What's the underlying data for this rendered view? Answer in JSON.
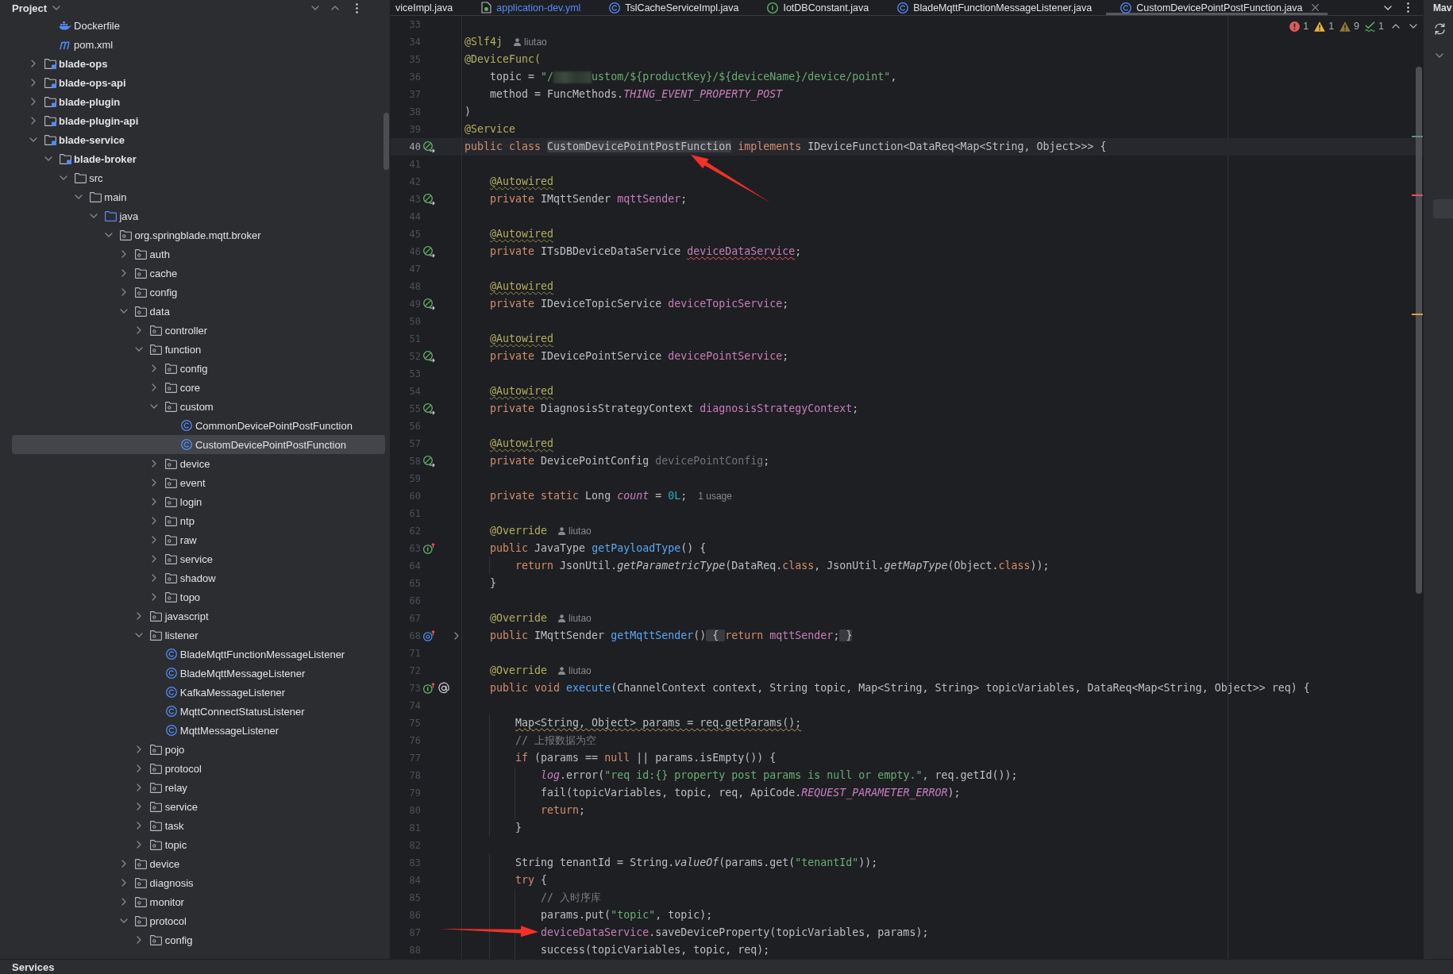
{
  "project": {
    "title": "Project",
    "tree": [
      {
        "children": [
          {
            "label": "Dockerfile",
            "kind": "docker",
            "selected": false
          },
          {
            "label": "pom.xml",
            "kind": "maven",
            "selected": false
          }
        ]
      },
      {
        "label": "blade-ops",
        "kind": "module",
        "expanded": false,
        "selected": false
      },
      {
        "label": "blade-ops-api",
        "kind": "module",
        "expanded": false,
        "selected": false
      },
      {
        "label": "blade-plugin",
        "kind": "module",
        "expanded": false,
        "selected": false
      },
      {
        "label": "blade-plugin-api",
        "kind": "module",
        "expanded": false,
        "selected": false
      },
      {
        "label": "blade-service",
        "kind": "module",
        "expanded": true,
        "selected": false,
        "children": [
          {
            "label": "blade-broker",
            "kind": "module",
            "expanded": true,
            "selected": false,
            "children": [
              {
                "label": "src",
                "kind": "folder",
                "expanded": true,
                "selected": false,
                "children": [
                  {
                    "label": "main",
                    "kind": "folder",
                    "expanded": true,
                    "selected": false,
                    "children": [
                      {
                        "label": "java",
                        "kind": "source-folder",
                        "expanded": true,
                        "selected": false,
                        "children": [
                          {
                            "label": "org.springblade.mqtt.broker",
                            "kind": "package",
                            "expanded": true,
                            "selected": false,
                            "children": [
                              {
                                "label": "auth",
                                "kind": "package",
                                "expanded": false,
                                "selected": false
                              },
                              {
                                "label": "cache",
                                "kind": "package",
                                "expanded": false,
                                "selected": false
                              },
                              {
                                "label": "config",
                                "kind": "package",
                                "expanded": false,
                                "selected": false
                              },
                              {
                                "label": "data",
                                "kind": "package",
                                "expanded": true,
                                "selected": false,
                                "children": [
                                  {
                                    "label": "controller",
                                    "kind": "package",
                                    "expanded": false,
                                    "selected": false
                                  },
                                  {
                                    "label": "function",
                                    "kind": "package",
                                    "expanded": true,
                                    "selected": false,
                                    "children": [
                                      {
                                        "label": "config",
                                        "kind": "package",
                                        "expanded": false,
                                        "selected": false
                                      },
                                      {
                                        "label": "core",
                                        "kind": "package",
                                        "expanded": false,
                                        "selected": false
                                      },
                                      {
                                        "label": "custom",
                                        "kind": "package",
                                        "expanded": true,
                                        "selected": false,
                                        "children": [
                                          {
                                            "label": "CommonDevicePointPostFunction",
                                            "kind": "class",
                                            "selected": false
                                          },
                                          {
                                            "label": "CustomDevicePointPostFunction",
                                            "kind": "class",
                                            "selected": true
                                          }
                                        ]
                                      },
                                      {
                                        "label": "device",
                                        "kind": "package",
                                        "expanded": false,
                                        "selected": false
                                      },
                                      {
                                        "label": "event",
                                        "kind": "package",
                                        "expanded": false,
                                        "selected": false
                                      },
                                      {
                                        "label": "login",
                                        "kind": "package",
                                        "expanded": false,
                                        "selected": false
                                      },
                                      {
                                        "label": "ntp",
                                        "kind": "package",
                                        "expanded": false,
                                        "selected": false
                                      },
                                      {
                                        "label": "raw",
                                        "kind": "package",
                                        "expanded": false,
                                        "selected": false
                                      },
                                      {
                                        "label": "service",
                                        "kind": "package",
                                        "expanded": false,
                                        "selected": false
                                      },
                                      {
                                        "label": "shadow",
                                        "kind": "package",
                                        "expanded": false,
                                        "selected": false
                                      },
                                      {
                                        "label": "topo",
                                        "kind": "package",
                                        "expanded": false,
                                        "selected": false
                                      }
                                    ]
                                  },
                                  {
                                    "label": "javascript",
                                    "kind": "package",
                                    "expanded": false,
                                    "selected": false
                                  },
                                  {
                                    "label": "listener",
                                    "kind": "package",
                                    "expanded": true,
                                    "selected": false,
                                    "children": [
                                      {
                                        "label": "BladeMqttFunctionMessageListener",
                                        "kind": "class",
                                        "selected": false
                                      },
                                      {
                                        "label": "BladeMqttMessageListener",
                                        "kind": "class",
                                        "selected": false
                                      },
                                      {
                                        "label": "KafkaMessageListener",
                                        "kind": "class",
                                        "selected": false
                                      },
                                      {
                                        "label": "MqttConnectStatusListener",
                                        "kind": "class",
                                        "selected": false
                                      },
                                      {
                                        "label": "MqttMessageListener",
                                        "kind": "class",
                                        "selected": false
                                      }
                                    ]
                                  },
                                  {
                                    "label": "pojo",
                                    "kind": "package",
                                    "expanded": false,
                                    "selected": false
                                  },
                                  {
                                    "label": "protocol",
                                    "kind": "package",
                                    "expanded": false,
                                    "selected": false
                                  },
                                  {
                                    "label": "relay",
                                    "kind": "package",
                                    "expanded": false,
                                    "selected": false
                                  },
                                  {
                                    "label": "service",
                                    "kind": "package",
                                    "expanded": false,
                                    "selected": false
                                  },
                                  {
                                    "label": "task",
                                    "kind": "package",
                                    "expanded": false,
                                    "selected": false
                                  },
                                  {
                                    "label": "topic",
                                    "kind": "package",
                                    "expanded": false,
                                    "selected": false
                                  }
                                ]
                              },
                              {
                                "label": "device",
                                "kind": "package",
                                "expanded": false,
                                "selected": false
                              },
                              {
                                "label": "diagnosis",
                                "kind": "package",
                                "expanded": false,
                                "selected": false
                              },
                              {
                                "label": "monitor",
                                "kind": "package",
                                "expanded": false,
                                "selected": false
                              },
                              {
                                "label": "protocol",
                                "kind": "package",
                                "expanded": true,
                                "selected": false,
                                "children": [
                                  {
                                    "label": "config",
                                    "kind": "package",
                                    "expanded": false,
                                    "selected": false
                                  }
                                ]
                              }
                            ]
                          }
                        ]
                      }
                    ]
                  }
                ]
              }
            ]
          }
        ]
      }
    ]
  },
  "editor": {
    "tabs": [
      {
        "label": "viceImpl.java",
        "selected": false,
        "modified": false
      },
      {
        "label": "application-dev.yml",
        "kind": "yaml",
        "selected": false,
        "modified": true
      },
      {
        "label": "TslCacheServiceImpl.java",
        "kind": "class",
        "selected": false,
        "modified": false
      },
      {
        "label": "IotDBConstant.java",
        "kind": "interface",
        "selected": false,
        "modified": false
      },
      {
        "label": "BladeMqttFunctionMessageListener.java",
        "kind": "class",
        "selected": false,
        "modified": false
      },
      {
        "label": "CustomDevicePointPostFunction.java",
        "kind": "class",
        "selected": true,
        "modified": false
      }
    ],
    "inspections": [
      {
        "kind": "error",
        "count": "1"
      },
      {
        "kind": "warning",
        "count": "1"
      },
      {
        "kind": "weak-warning",
        "count": "9"
      },
      {
        "kind": "typo",
        "count": "1"
      }
    ],
    "lines": [
      {
        "number": "33",
        "current": false
      },
      {
        "number": "34",
        "current": false,
        "tokens": [
          {
            "text": "@Slf4j",
            "kind": "annotation"
          }
        ],
        "hint": {
          "kind": "author",
          "text": "liutao"
        }
      },
      {
        "number": "35",
        "current": false,
        "tokens": [
          {
            "text": "@DeviceFunc(",
            "kind": "annotation"
          }
        ]
      },
      {
        "number": "36",
        "current": false,
        "tokens": [
          {
            "text": "    topic = ",
            "kind": "plain"
          },
          {
            "text": "\"/",
            "kind": "string"
          },
          {
            "kind": "redacted"
          },
          {
            "text": "ustom/${productKey}/${deviceName}/device/point\"",
            "kind": "string"
          },
          {
            "text": ",",
            "kind": "plain"
          }
        ]
      },
      {
        "number": "37",
        "current": false,
        "tokens": [
          {
            "text": "    method = FuncMethods.",
            "kind": "plain"
          },
          {
            "text": "THING_EVENT_PROPERTY_POST",
            "kind": "static-field"
          }
        ]
      },
      {
        "number": "38",
        "current": false,
        "tokens": [
          {
            "text": ")",
            "kind": "plain"
          }
        ]
      },
      {
        "number": "39",
        "current": false,
        "tokens": [
          {
            "text": "@Service",
            "kind": "annotation"
          }
        ]
      },
      {
        "number": "40",
        "current": true,
        "gutter": [
          {
            "kind": "bean"
          }
        ],
        "tokens": [
          {
            "text": "public class ",
            "kind": "keyword"
          },
          {
            "text": "CustomDevicePointPostFunction",
            "kind": "plain",
            "highlight": true,
            "pointer": {
              "kind": "from-below-right"
            }
          },
          {
            "text": " implements ",
            "kind": "keyword"
          },
          {
            "text": "IDeviceFunction<DataReq<Map<String, Object>>> {",
            "kind": "plain"
          }
        ]
      },
      {
        "number": "41",
        "current": false
      },
      {
        "number": "42",
        "current": false,
        "tokens": [
          {
            "text": "    @Autowired",
            "kind": "annotation",
            "squiggle": {
              "kind": "weak"
            }
          }
        ]
      },
      {
        "number": "43",
        "current": false,
        "gutter": [
          {
            "kind": "bean"
          }
        ],
        "tokens": [
          {
            "text": "    private ",
            "kind": "keyword"
          },
          {
            "text": "IMqttSender ",
            "kind": "plain"
          },
          {
            "text": "mqttSender",
            "kind": "field"
          },
          {
            "text": ";",
            "kind": "plain"
          }
        ]
      },
      {
        "number": "44",
        "current": false
      },
      {
        "number": "45",
        "current": false,
        "tokens": [
          {
            "text": "    @Autowired",
            "kind": "annotation",
            "squiggle": {
              "kind": "weak"
            }
          }
        ]
      },
      {
        "number": "46",
        "current": false,
        "gutter": [
          {
            "kind": "bean"
          }
        ],
        "tokens": [
          {
            "text": "    private ",
            "kind": "keyword"
          },
          {
            "text": "ITsDBDeviceDataService ",
            "kind": "plain"
          },
          {
            "text": "deviceDataService",
            "kind": "field",
            "squiggle": {
              "kind": "error"
            }
          },
          {
            "text": ";",
            "kind": "plain"
          }
        ]
      },
      {
        "number": "47",
        "current": false
      },
      {
        "number": "48",
        "current": false,
        "tokens": [
          {
            "text": "    @Autowired",
            "kind": "annotation",
            "squiggle": {
              "kind": "weak"
            }
          }
        ]
      },
      {
        "number": "49",
        "current": false,
        "gutter": [
          {
            "kind": "bean"
          }
        ],
        "tokens": [
          {
            "text": "    private ",
            "kind": "keyword"
          },
          {
            "text": "IDeviceTopicService ",
            "kind": "plain"
          },
          {
            "text": "deviceTopicService",
            "kind": "field"
          },
          {
            "text": ";",
            "kind": "plain"
          }
        ]
      },
      {
        "number": "50",
        "current": false
      },
      {
        "number": "51",
        "current": false,
        "tokens": [
          {
            "text": "    @Autowired",
            "kind": "annotation",
            "squiggle": {
              "kind": "weak"
            }
          }
        ]
      },
      {
        "number": "52",
        "current": false,
        "gutter": [
          {
            "kind": "bean"
          }
        ],
        "tokens": [
          {
            "text": "    private ",
            "kind": "keyword"
          },
          {
            "text": "IDevicePointService ",
            "kind": "plain"
          },
          {
            "text": "devicePointService",
            "kind": "field"
          },
          {
            "text": ";",
            "kind": "plain"
          }
        ]
      },
      {
        "number": "53",
        "current": false
      },
      {
        "number": "54",
        "current": false,
        "tokens": [
          {
            "text": "    @Autowired",
            "kind": "annotation",
            "squiggle": {
              "kind": "weak"
            }
          }
        ]
      },
      {
        "number": "55",
        "current": false,
        "gutter": [
          {
            "kind": "bean"
          }
        ],
        "tokens": [
          {
            "text": "    private ",
            "kind": "keyword"
          },
          {
            "text": "DiagnosisStrategyContext ",
            "kind": "plain"
          },
          {
            "text": "diagnosisStrategyContext",
            "kind": "field"
          },
          {
            "text": ";",
            "kind": "plain"
          }
        ]
      },
      {
        "number": "56",
        "current": false
      },
      {
        "number": "57",
        "current": false,
        "tokens": [
          {
            "text": "    @Autowired",
            "kind": "annotation",
            "squiggle": {
              "kind": "weak"
            }
          }
        ]
      },
      {
        "number": "58",
        "current": false,
        "gutter": [
          {
            "kind": "bean"
          }
        ],
        "tokens": [
          {
            "text": "    private ",
            "kind": "keyword"
          },
          {
            "text": "DevicePointConfig ",
            "kind": "plain"
          },
          {
            "text": "devicePointConfig",
            "kind": "unused"
          },
          {
            "text": ";",
            "kind": "plain"
          }
        ]
      },
      {
        "number": "59",
        "current": false
      },
      {
        "number": "60",
        "current": false,
        "tokens": [
          {
            "text": "    private static ",
            "kind": "keyword"
          },
          {
            "text": "Long ",
            "kind": "plain"
          },
          {
            "text": "count",
            "kind": "static-field"
          },
          {
            "text": " = ",
            "kind": "plain"
          },
          {
            "text": "0L",
            "kind": "number"
          },
          {
            "text": ";",
            "kind": "plain"
          }
        ],
        "hint": {
          "kind": "usages",
          "text": "1 usage"
        }
      },
      {
        "number": "61",
        "current": false
      },
      {
        "number": "62",
        "current": false,
        "tokens": [
          {
            "text": "    @Override",
            "kind": "annotation"
          }
        ],
        "hint": {
          "kind": "author",
          "text": "liutao"
        }
      },
      {
        "number": "63",
        "current": false,
        "gutter": [
          {
            "kind": "implements"
          }
        ],
        "tokens": [
          {
            "text": "    public ",
            "kind": "keyword"
          },
          {
            "text": "JavaType ",
            "kind": "plain"
          },
          {
            "text": "getPayloadType",
            "kind": "method"
          },
          {
            "text": "() {",
            "kind": "plain"
          }
        ]
      },
      {
        "number": "64",
        "current": false,
        "tokens": [
          {
            "text": "        return ",
            "kind": "keyword"
          },
          {
            "text": "JsonUtil.",
            "kind": "plain"
          },
          {
            "text": "getParametricType",
            "kind": "static-call"
          },
          {
            "text": "(DataReq.",
            "kind": "plain"
          },
          {
            "text": "class",
            "kind": "keyword"
          },
          {
            "text": ", JsonUtil.",
            "kind": "plain"
          },
          {
            "text": "getMapType",
            "kind": "static-call"
          },
          {
            "text": "(Object.",
            "kind": "plain"
          },
          {
            "text": "class",
            "kind": "keyword"
          },
          {
            "text": "));",
            "kind": "plain"
          }
        ]
      },
      {
        "number": "65",
        "current": false,
        "tokens": [
          {
            "text": "    }",
            "kind": "plain"
          }
        ]
      },
      {
        "number": "66",
        "current": false
      },
      {
        "number": "67",
        "current": false,
        "tokens": [
          {
            "text": "    @Override",
            "kind": "annotation"
          }
        ],
        "hint": {
          "kind": "author",
          "text": "liutao"
        }
      },
      {
        "number": "68",
        "current": false,
        "folded": true,
        "gutter": [
          {
            "kind": "overrides"
          }
        ],
        "tokens": [
          {
            "text": "    public ",
            "kind": "keyword"
          },
          {
            "text": "IMqttSender ",
            "kind": "plain"
          },
          {
            "text": "getMqttSender",
            "kind": "method"
          },
          {
            "text": "()",
            "kind": "plain"
          },
          {
            "text": " { ",
            "kind": "plain",
            "placeholder": true
          },
          {
            "text": "return ",
            "kind": "keyword"
          },
          {
            "text": "mqttSender",
            "kind": "field"
          },
          {
            "text": ";",
            "kind": "plain"
          },
          {
            "text": " }",
            "kind": "plain",
            "placeholder": true
          }
        ]
      },
      {
        "number": "71",
        "current": false
      },
      {
        "number": "72",
        "current": false,
        "tokens": [
          {
            "text": "    @Override",
            "kind": "annotation"
          }
        ],
        "hint": {
          "kind": "author",
          "text": "liutao"
        }
      },
      {
        "number": "73",
        "current": false,
        "gutter": [
          {
            "kind": "implements"
          },
          {
            "kind": "endpoint"
          }
        ],
        "tokens": [
          {
            "text": "    public void ",
            "kind": "keyword"
          },
          {
            "text": "execute",
            "kind": "method"
          },
          {
            "text": "(ChannelContext context, String topic, Map<String, String> topicVariables, DataReq<Map<String, Object>> req) {",
            "kind": "plain"
          }
        ]
      },
      {
        "number": "74",
        "current": false
      },
      {
        "number": "75",
        "current": false,
        "tokens": [
          {
            "text": "        Map<String, Object> params = req.getParams();",
            "kind": "plain",
            "squiggle": {
              "kind": "warning"
            }
          }
        ]
      },
      {
        "number": "76",
        "current": false,
        "tokens": [
          {
            "text": "        // 上报数据为空",
            "kind": "comment"
          }
        ]
      },
      {
        "number": "77",
        "current": false,
        "tokens": [
          {
            "text": "        if ",
            "kind": "keyword"
          },
          {
            "text": "(params == ",
            "kind": "plain"
          },
          {
            "text": "null",
            "kind": "keyword"
          },
          {
            "text": " || params.isEmpty()) {",
            "kind": "plain"
          }
        ]
      },
      {
        "number": "78",
        "current": false,
        "tokens": [
          {
            "text": "            log",
            "kind": "static-field"
          },
          {
            "text": ".error(",
            "kind": "plain"
          },
          {
            "text": "\"req id:{} property post params is null or empty.\"",
            "kind": "string"
          },
          {
            "text": ", req.getId());",
            "kind": "plain"
          }
        ]
      },
      {
        "number": "79",
        "current": false,
        "tokens": [
          {
            "text": "            fail(topicVariables, topic, req, ApiCode.",
            "kind": "plain"
          },
          {
            "text": "REQUEST_PARAMETER_ERROR",
            "kind": "static-field"
          },
          {
            "text": ");",
            "kind": "plain"
          }
        ]
      },
      {
        "number": "80",
        "current": false,
        "tokens": [
          {
            "text": "            return",
            "kind": "keyword"
          },
          {
            "text": ";",
            "kind": "plain"
          }
        ]
      },
      {
        "number": "81",
        "current": false,
        "tokens": [
          {
            "text": "        }",
            "kind": "plain"
          }
        ]
      },
      {
        "number": "82",
        "current": false
      },
      {
        "number": "83",
        "current": false,
        "tokens": [
          {
            "text": "        String tenantId = String.",
            "kind": "plain"
          },
          {
            "text": "valueOf",
            "kind": "static-call"
          },
          {
            "text": "(params.get(",
            "kind": "plain"
          },
          {
            "text": "\"tenantId\"",
            "kind": "string"
          },
          {
            "text": "));",
            "kind": "plain"
          }
        ]
      },
      {
        "number": "84",
        "current": false,
        "tokens": [
          {
            "text": "        try",
            "kind": "keyword"
          },
          {
            "text": " {",
            "kind": "plain"
          }
        ]
      },
      {
        "number": "85",
        "current": false,
        "tokens": [
          {
            "text": "            // 入时序库",
            "kind": "comment"
          }
        ]
      },
      {
        "number": "86",
        "current": false,
        "tokens": [
          {
            "text": "            params.put(",
            "kind": "plain"
          },
          {
            "text": "\"topic\"",
            "kind": "string"
          },
          {
            "text": ", topic);",
            "kind": "plain"
          }
        ]
      },
      {
        "number": "87",
        "current": false,
        "tokens": [
          {
            "text": "            deviceDataService",
            "kind": "field",
            "pointer": {
              "kind": "from-left"
            }
          },
          {
            "text": ".saveDeviceProperty(topicVariables, params);",
            "kind": "plain"
          }
        ]
      },
      {
        "number": "88",
        "current": false,
        "tokens": [
          {
            "text": "            success(topicVariables, topic, req);",
            "kind": "plain"
          }
        ]
      }
    ],
    "stripe_marks": [
      {
        "kind": "info"
      },
      {
        "kind": "error"
      },
      {
        "kind": "warning"
      }
    ]
  },
  "right_panel": {
    "title": "Mav"
  },
  "bottom_bar": {
    "title": "Services"
  }
}
